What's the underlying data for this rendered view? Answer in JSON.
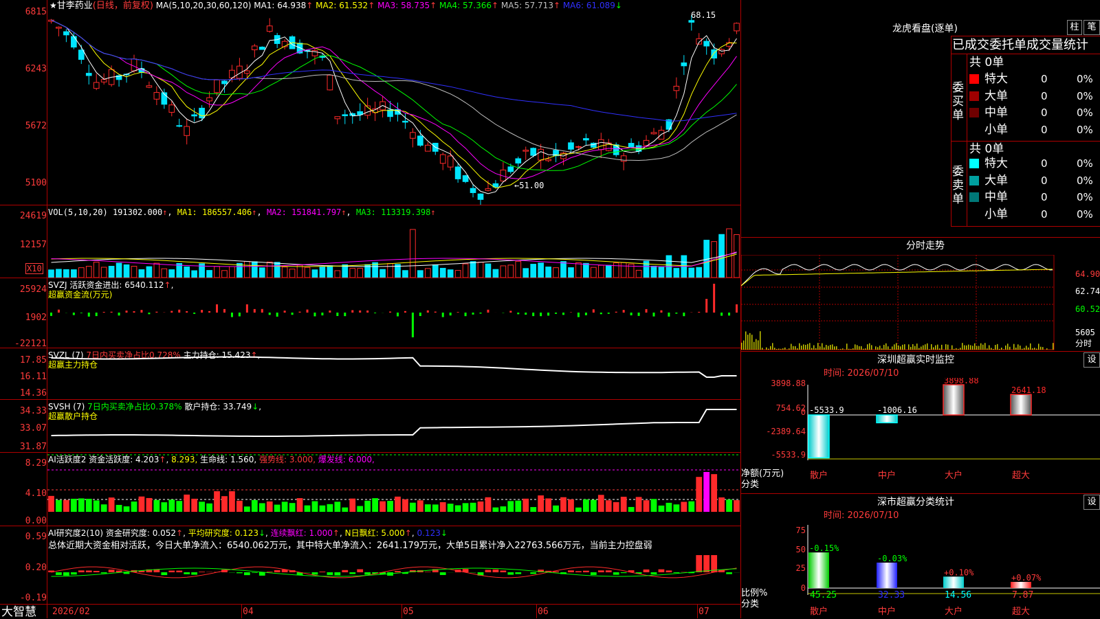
{
  "stock": {
    "star": "★",
    "name": "甘李药业",
    "period": "(日线，前复权)",
    "ma_params": "MA(5,10,20,30,60,120)",
    "ma": [
      {
        "label": "MA1:",
        "value": "64.938",
        "arrow": "↑",
        "color": "#ffffff"
      },
      {
        "label": "MA2:",
        "value": "61.532",
        "arrow": "↑",
        "color": "#ffff00"
      },
      {
        "label": "MA3:",
        "value": "58.735",
        "arrow": "↑",
        "color": "#ff00ff"
      },
      {
        "label": "MA4:",
        "value": "57.366",
        "arrow": "↑",
        "color": "#00ff00"
      },
      {
        "label": "MA5:",
        "value": "57.713",
        "arrow": "↑",
        "color": "#c0c0c0"
      },
      {
        "label": "MA6:",
        "value": "61.089",
        "arrow": "↓",
        "color": "#3030ff"
      }
    ],
    "high_label": "68.15",
    "low_label": "←51.00"
  },
  "price_axis": [
    "6815",
    "6243",
    "5672",
    "5100"
  ],
  "vol": {
    "header": "VOL(5,10,20)",
    "value": "191302.000",
    "ma1": "MA1: 186557.406",
    "ma2": "MA2: 151841.797",
    "ma3": "MA3: 113319.398",
    "axis": [
      "24619",
      "12157"
    ],
    "unit": "X10"
  },
  "svzj": {
    "header": "SVZJ  活跃资金进出: 6540.112",
    "sub": "超赢资金流(万元)",
    "axis": [
      "25924",
      "1902",
      "-22121"
    ]
  },
  "svzl": {
    "header": "SVZL (7)",
    "ratio": "7日内买卖净占比0.728%",
    "hold": "主力持仓: 15.423",
    "sub": "超赢主力持仓",
    "axis": [
      "17.85",
      "16.11",
      "14.36"
    ]
  },
  "svsh": {
    "header": "SVSH (7)",
    "ratio": "7日内买卖净占比0.378%",
    "hold": "散户持仓: 33.749",
    "sub": "超赢散户持仓",
    "axis": [
      "34.33",
      "33.07",
      "31.87"
    ]
  },
  "ai1": {
    "header": "AI活跃度2 资金活跃度: 4.203",
    "v2": "8.293,",
    "life": "生命线: 1.560,",
    "strong": "强势线: 3.000,",
    "burst": "爆发线: 6.000,",
    "axis": [
      "8.29",
      "4.10",
      "0.00"
    ]
  },
  "ai2": {
    "header": "AI研究度2(10) 资金研究度: 0.052",
    "avg": "平均研究度: 0.123",
    "red": "连续飘红: 1.000",
    "nred": "N日飘红: 5.000",
    "last": "0.123",
    "summary": "总体近期大资金相对活跃，今日大单净流入：6540.062万元，其中特大单净流入：2641.179万元，大单5日累计净入22763.566万元，当前主力控盘弱",
    "axis": [
      "0.59",
      "0.20",
      "-0.19"
    ]
  },
  "xaxis": {
    "brand": "大智慧",
    "labels": [
      "2026/02",
      "04",
      "05",
      "06",
      "07"
    ]
  },
  "right": {
    "lhb_title": "龙虎看盘(逐单)",
    "btn1": "柱",
    "btn2": "笔",
    "table_title": "已成交委托单成交量统计",
    "buy_label": "委买单",
    "sell_label": "委卖单",
    "buy_total": "共 0单",
    "sell_total": "共 0单",
    "buy_rows": [
      {
        "name": "特大",
        "count": "0",
        "pct": "0%",
        "color": "#ff0000"
      },
      {
        "name": "大单",
        "count": "0",
        "pct": "0%",
        "color": "#a00000"
      },
      {
        "name": "中单",
        "count": "0",
        "pct": "0%",
        "color": "#700000"
      },
      {
        "name": "小单",
        "count": "0",
        "pct": "0%",
        "color": "#000000"
      }
    ],
    "sell_rows": [
      {
        "name": "特大",
        "count": "0",
        "pct": "0%",
        "color": "#00ffff"
      },
      {
        "name": "大单",
        "count": "0",
        "pct": "0%",
        "color": "#00a0a0"
      },
      {
        "name": "中单",
        "count": "0",
        "pct": "0%",
        "color": "#007878"
      },
      {
        "name": "小单",
        "count": "0",
        "pct": "0%",
        "color": "#000000"
      }
    ],
    "intraday_title": "分时走势",
    "intraday_axis": [
      "64.90",
      "62.74",
      "60.52"
    ],
    "intraday_vol_axis": [
      "5605",
      "分时"
    ],
    "monitor_title": "深圳超赢实时监控",
    "set_label": "设",
    "monitor_time": "时间: 2026/07/10",
    "monitor_axis": [
      "3898.88",
      "754.62",
      "0",
      "-2389.64",
      "-5533.9"
    ],
    "monitor_ylab": [
      "净额(万元)",
      "分类"
    ],
    "monitor_bars": [
      {
        "cat": "散户",
        "value": -5533.9,
        "label": "-5533.9"
      },
      {
        "cat": "中户",
        "value": -1006.16,
        "label": "-1006.16"
      },
      {
        "cat": "大户",
        "value": 3898.88,
        "label": "3898.88"
      },
      {
        "cat": "超大",
        "value": 2641.18,
        "label": "2641.18"
      }
    ],
    "class_title": "深市超赢分类统计",
    "class_time": "时间: 2026/07/10",
    "class_axis": [
      "75",
      "50",
      "25",
      "0"
    ],
    "class_ylab": [
      "比例%",
      "分类"
    ],
    "class_bars": [
      {
        "cat": "散户",
        "value": 45.25,
        "label": "45.25",
        "delta": "-0.15%"
      },
      {
        "cat": "中户",
        "value": 32.33,
        "label": "32.33",
        "delta": "-0.03%"
      },
      {
        "cat": "大户",
        "value": 14.56,
        "label": "14.56",
        "delta": "+0.10%"
      },
      {
        "cat": "超大",
        "value": 7.87,
        "label": "7.87",
        "delta": "+0.07%"
      }
    ]
  },
  "colors": {
    "up": "#ff2a2a",
    "down": "#00e5ff",
    "frame": "#b00000"
  }
}
